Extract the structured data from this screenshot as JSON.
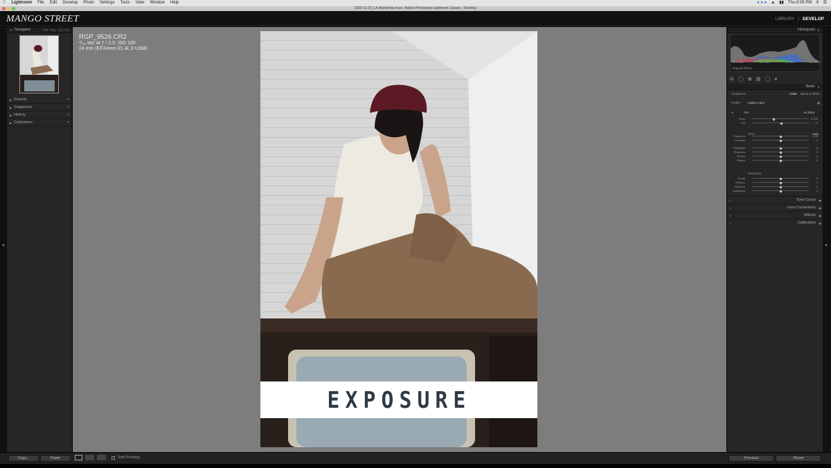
{
  "menubar": {
    "app": "Lightroom",
    "items": [
      "File",
      "Edit",
      "Develop",
      "Photo",
      "Settings",
      "Tools",
      "View",
      "Window",
      "Help"
    ],
    "clock": "Thu 8:05 PM"
  },
  "window": {
    "title": "2018 11 02_LA Workshop.lrcat - Adobe Photoshop Lightroom Classic - Develop"
  },
  "topbar": {
    "brand": "MANGO STREET",
    "modules": [
      "LIBRARY",
      "DEVELOP"
    ],
    "divider": "|"
  },
  "left": {
    "navigator": {
      "title": "Navigator",
      "zoom": [
        "FIT",
        "FILL",
        "1:1",
        "3:1"
      ]
    },
    "sections": [
      {
        "label": "Presets",
        "action": "+"
      },
      {
        "label": "Snapshots",
        "action": "+"
      },
      {
        "label": "History",
        "action": "×"
      },
      {
        "label": "Collections",
        "action": "+"
      }
    ],
    "copy_label": "Copy...",
    "paste_label": "Paste"
  },
  "photo": {
    "filename": "RGP_9526.CR2",
    "exposure_line": "¹/₄₀ sec at ƒ / 2.5, ISO 100",
    "lens_line": "24 mm (EF24mm f/1.4L II USM)",
    "overlay_text": "EXPOSURE"
  },
  "toolbar": {
    "soft_proofing": "Soft Proofing"
  },
  "right": {
    "histogram": {
      "title": "Histogram",
      "readout": [
        "ISO 100",
        "24 mm",
        "ƒ / 2.5",
        "¹/₄₀ sec"
      ],
      "original_photo": "Original Photo"
    },
    "basic": {
      "title": "Basic",
      "treatment_label": "Treatment :",
      "treatment_options": [
        "Color",
        "Black & White"
      ],
      "profile_label": "Profile :",
      "profile_value": "Adobe Color",
      "wb_label": "WB :",
      "wb_value": "As Shot",
      "tone_label": "Tone",
      "auto_label": "Auto",
      "presence_label": "Presence",
      "sliders": [
        {
          "label": "Temp",
          "value": "5,200",
          "pos": 0.38
        },
        {
          "label": "Tint",
          "value": "+ 8",
          "pos": 0.52
        },
        {
          "label": "Exposure",
          "value": "0.00",
          "pos": 0.5
        },
        {
          "label": "Contrast",
          "value": "0",
          "pos": 0.5
        },
        {
          "label": "Highlights",
          "value": "0",
          "pos": 0.5
        },
        {
          "label": "Shadows",
          "value": "0",
          "pos": 0.5
        },
        {
          "label": "Whites",
          "value": "0",
          "pos": 0.5
        },
        {
          "label": "Blacks",
          "value": "0",
          "pos": 0.5
        },
        {
          "label": "Clarity",
          "value": "0",
          "pos": 0.5
        },
        {
          "label": "Dehaze",
          "value": "0",
          "pos": 0.5
        },
        {
          "label": "Vibrance",
          "value": "0",
          "pos": 0.5
        },
        {
          "label": "Saturation",
          "value": "0",
          "pos": 0.5
        }
      ]
    },
    "sections": [
      "Tone Curve",
      "Lens Corrections",
      "Effects",
      "Calibration"
    ],
    "previous_label": "Previous",
    "reset_label": "Reset"
  },
  "colors": {
    "accent": "#ffffff",
    "panel": "#262626",
    "canvas": "#7d7d7d"
  }
}
